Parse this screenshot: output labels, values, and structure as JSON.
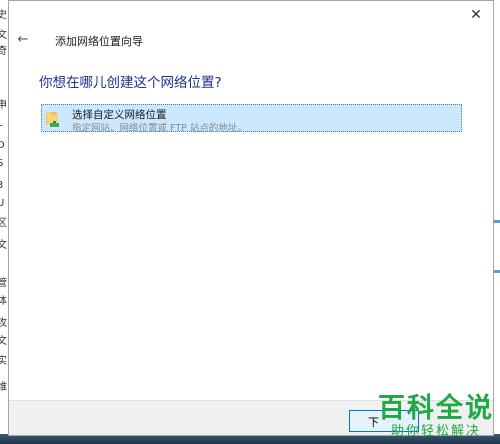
{
  "background": {
    "left_fragments": [
      "史",
      "文",
      "奇",
      "申",
      "L",
      "D",
      "S",
      "3",
      "U",
      "文",
      "区",
      "管",
      "体",
      "攻",
      "文",
      "实",
      "维"
    ]
  },
  "dialog": {
    "close_glyph": "✕",
    "back_glyph": "←",
    "title": "添加网络位置向导",
    "heading": "你想在哪儿创建这个网络位置?",
    "option": {
      "title": "选择自定义网络位置",
      "description": "指定网站、网络位置或 FTP 站点的地址。",
      "icon": "folder-network-icon"
    },
    "next_button_label": "下"
  },
  "watermark": {
    "main": "百科全说",
    "sub": "助你轻松解决"
  },
  "colors": {
    "heading": "#1e3287",
    "selection_bg": "#cce8ff",
    "selection_border": "#3c7fb1",
    "watermark": "#1fa845"
  }
}
